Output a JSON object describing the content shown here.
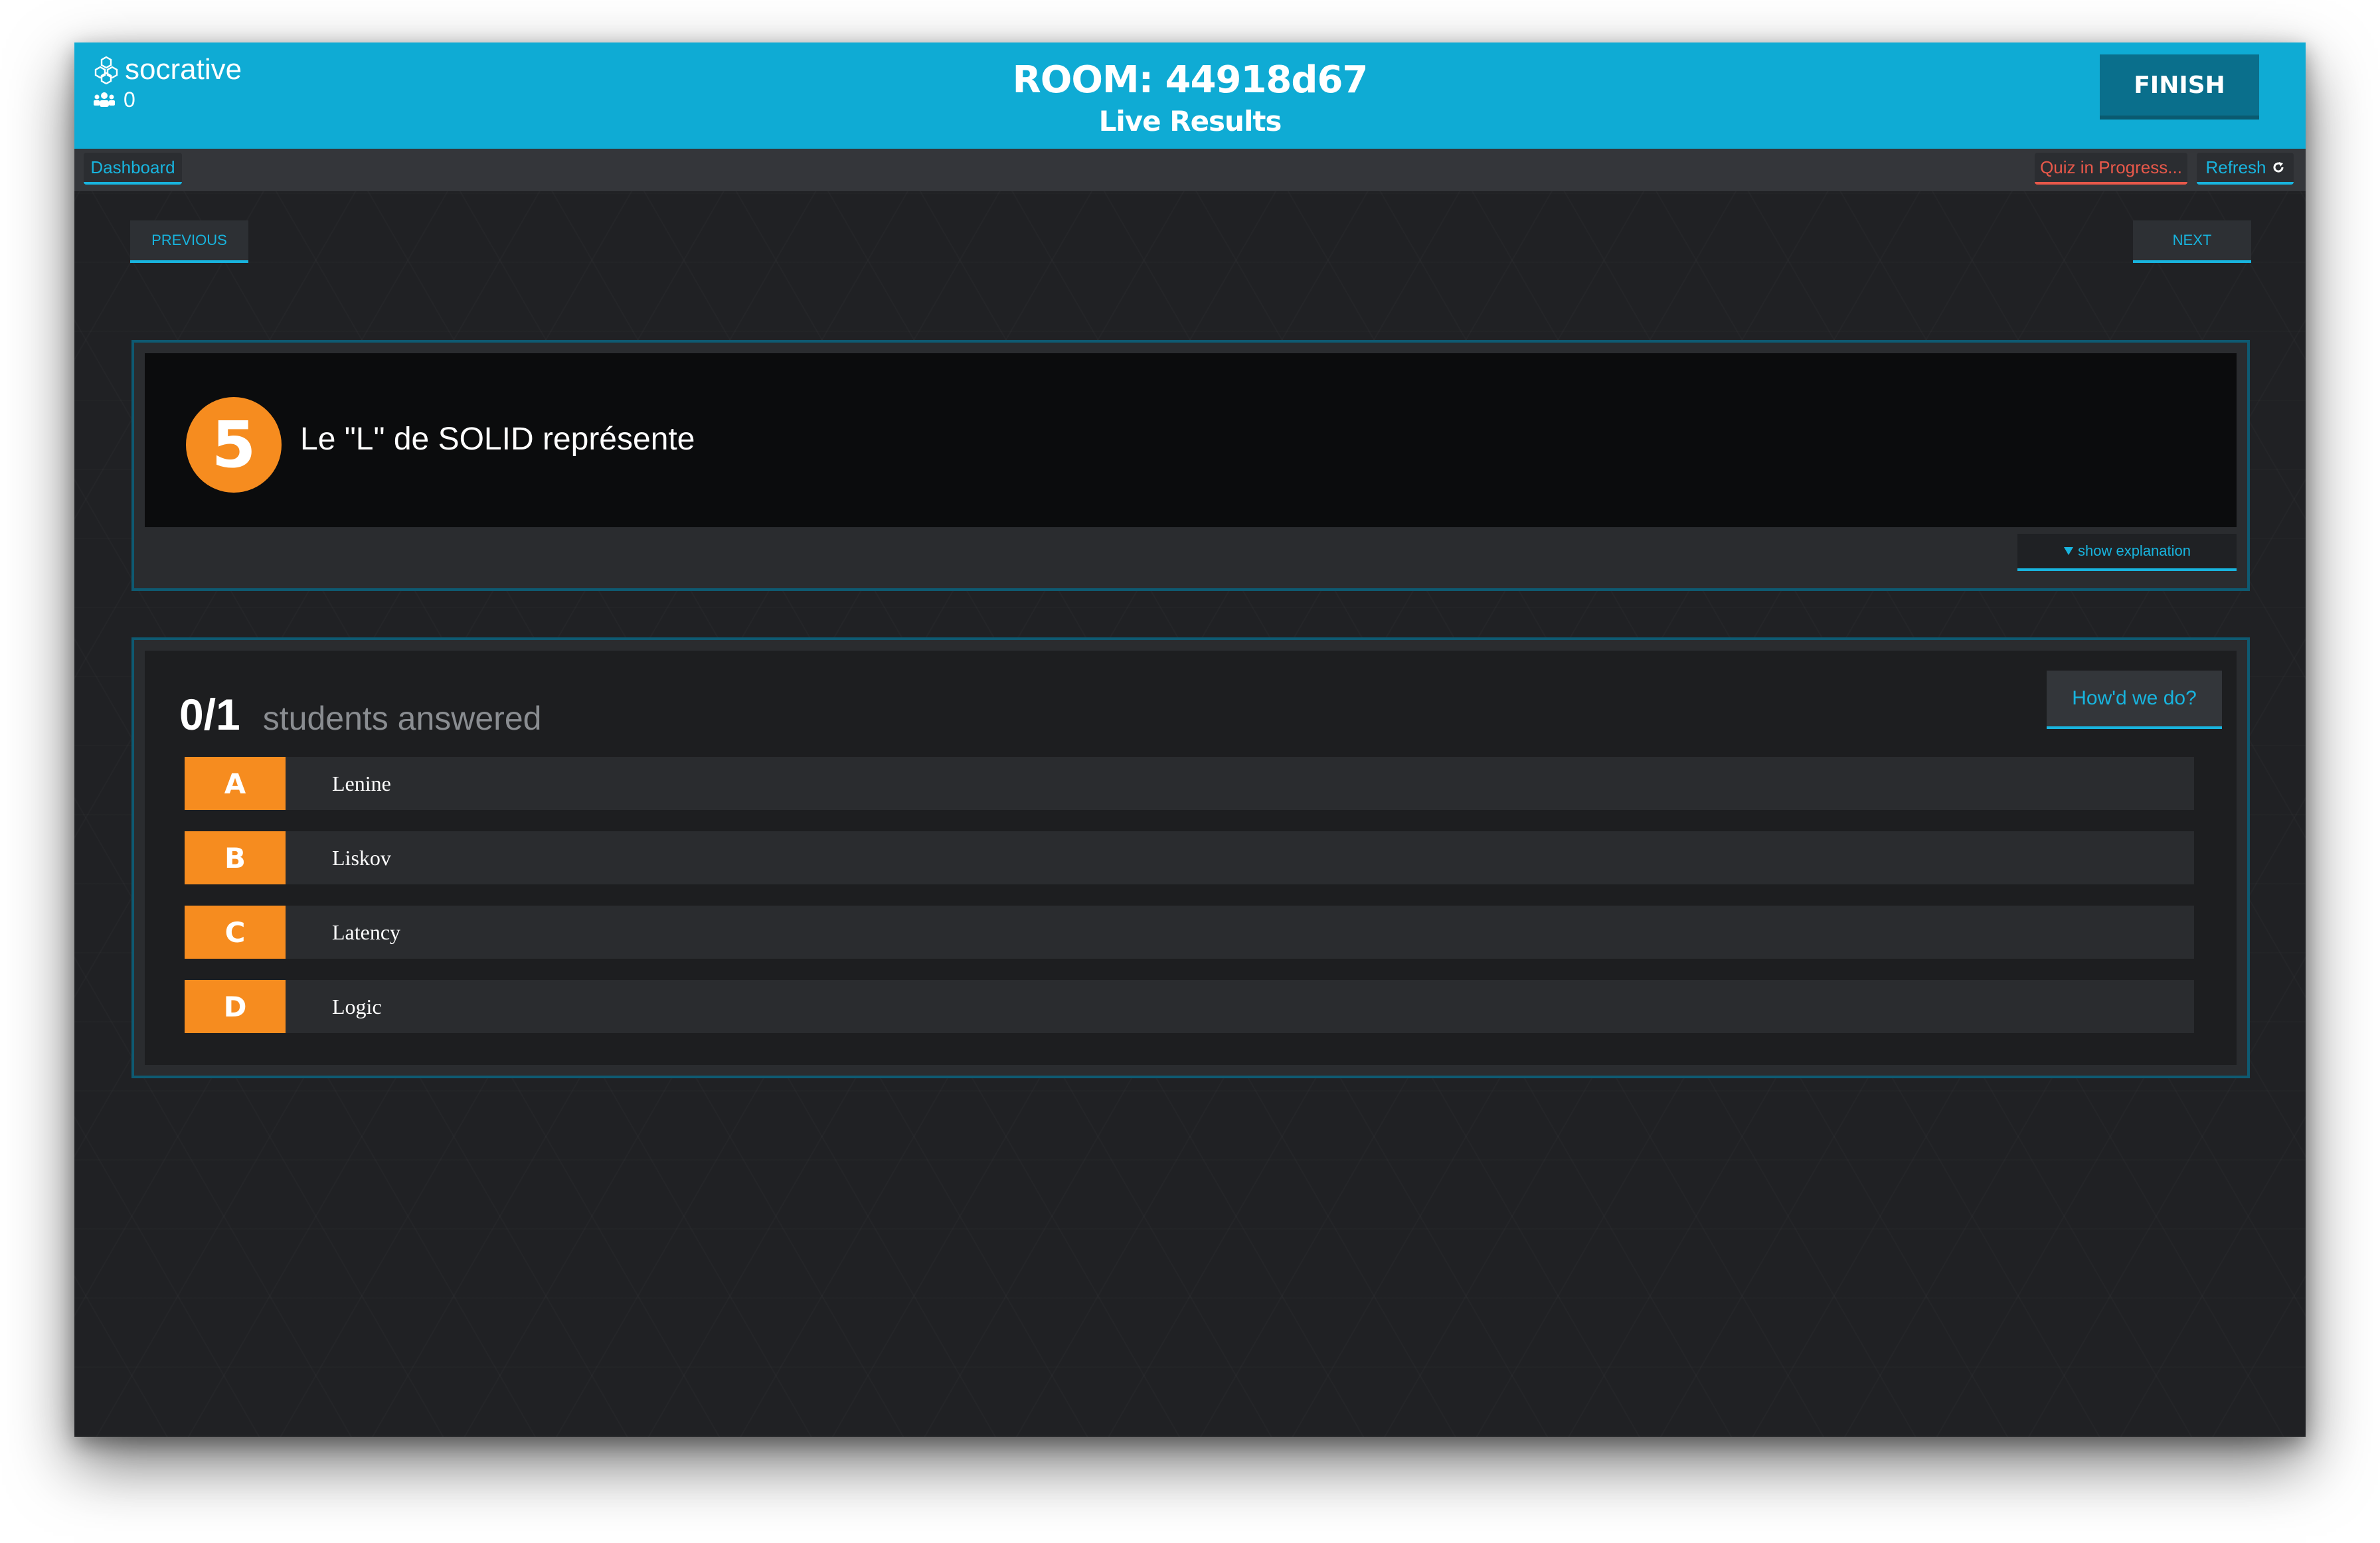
{
  "header": {
    "logo_text": "socrative",
    "student_count": "0",
    "room": "ROOM: 44918d67",
    "subtitle": "Live Results",
    "finish_label": "FINISH"
  },
  "subnav": {
    "dashboard_label": "Dashboard",
    "quiz_status_label": "Quiz in Progress...",
    "refresh_label": "Refresh"
  },
  "pager": {
    "previous_label": "PREVIOUS",
    "next_label": "NEXT"
  },
  "question": {
    "number": "5",
    "text": "Le \"L\" de SOLID représente",
    "explanation_label": "show explanation"
  },
  "results": {
    "answered": "0/1",
    "answered_label": "students answered",
    "howd_label": "How'd we do?",
    "answers": [
      {
        "letter": "A",
        "text": "Lenine"
      },
      {
        "letter": "B",
        "text": "Liskov"
      },
      {
        "letter": "C",
        "text": "Latency"
      },
      {
        "letter": "D",
        "text": "Logic"
      }
    ]
  },
  "colors": {
    "header": "#0fabd4",
    "accent": "#18b4de",
    "orange": "#f68c1f",
    "alert": "#e8584a",
    "background": "#202124"
  },
  "icons": {
    "logo": "hexagon-cluster-icon",
    "students": "users-icon",
    "refresh": "refresh-icon",
    "explanation": "triangle-down-icon"
  }
}
